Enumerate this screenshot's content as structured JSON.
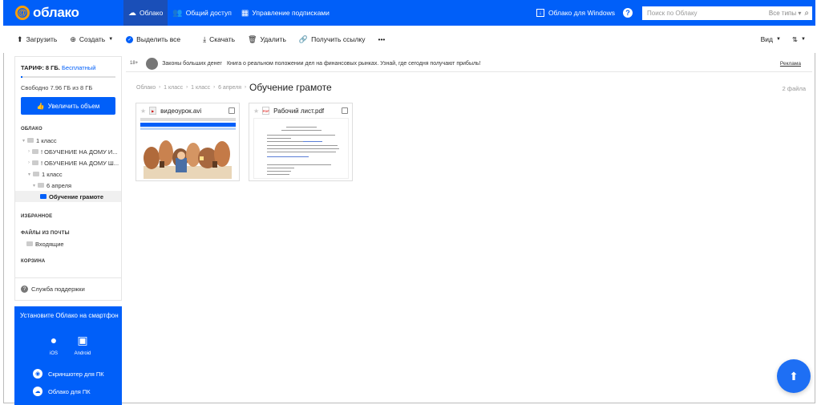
{
  "app": {
    "logo_symbol": "@",
    "logo_text": "облако",
    "brand_color": "#005ff9",
    "accent_color": "#ff9e00"
  },
  "topnav": {
    "tabs": [
      {
        "label": "Облако",
        "icon": "cloud-icon",
        "active": true
      },
      {
        "label": "Общий доступ",
        "icon": "users-icon",
        "active": false
      },
      {
        "label": "Управление подписками",
        "icon": "subscriptions-icon",
        "active": false
      }
    ],
    "windows_link": "Облако для Windows",
    "help_icon": "?",
    "search": {
      "placeholder": "Поиск по Облаку",
      "types": "Все типы"
    }
  },
  "toolbar": {
    "upload": "Загрузить",
    "create": "Создать",
    "select_all": "Выделить все",
    "download": "Скачать",
    "delete": "Удалить",
    "get_link": "Получить ссылку",
    "more": "•••",
    "view": "Вид",
    "sort": "⇅"
  },
  "sidebar": {
    "tariff_label": "ТАРИФ: 8 ГБ.",
    "tariff_type": "Бесплатный",
    "usage_fraction": 0.005,
    "free_space": "Свободно 7.96 ГБ из 8 ГБ",
    "upgrade_button": "Увеличить объем",
    "section_cloud": "ОБЛАКО",
    "tree": [
      {
        "label": "1 класс",
        "level": 0,
        "active": false
      },
      {
        "label": "! ОБУЧЕНИЕ НА ДОМУ И...",
        "level": 1,
        "active": false
      },
      {
        "label": "! ОБУЧЕНИЕ НА ДОМУ Ш...",
        "level": 1,
        "active": false
      },
      {
        "label": "1 класс",
        "level": 1,
        "active": false
      },
      {
        "label": "6 апреля",
        "level": 2,
        "active": false
      },
      {
        "label": "Обучение грамоте",
        "level": 3,
        "active": true
      }
    ],
    "section_favorites": "ИЗБРАННОЕ",
    "section_mail": "ФАЙЛЫ ИЗ ПОЧТЫ",
    "inbox": "Входящие",
    "section_trash": "КОРЗИНА",
    "support": "Служба поддержки"
  },
  "promo": {
    "title": "Установите Облако на смартфон",
    "ios": "iOS",
    "android": "Android",
    "screenshoter": "Скриншотер для ПК",
    "cloud_pc": "Облако для ПК"
  },
  "ad": {
    "age": "18+",
    "title": "Законы больших денег",
    "text": "Книга о реальном положении дел на финансовых рынках. Узнай, где сегодня получают прибыль!",
    "label": "Реклама"
  },
  "breadcrumbs": {
    "items": [
      "Облако",
      "1 класс",
      "1 класс",
      "6 апреля"
    ],
    "current": "Обучение грамоте",
    "separator": "›"
  },
  "files_count": "2 файла",
  "files": [
    {
      "name": "видеоурок.avi",
      "type": "video"
    },
    {
      "name": "Рабочий лист.pdf",
      "type": "pdf",
      "badge": "PDF"
    }
  ]
}
